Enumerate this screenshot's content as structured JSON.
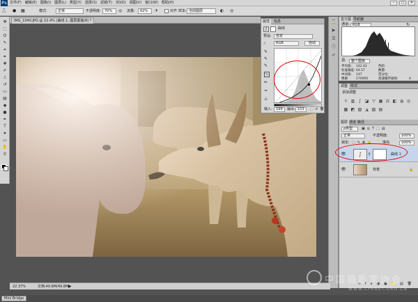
{
  "app": {
    "logo": "Ps"
  },
  "menubar": {
    "items": [
      "文件(F)",
      "编辑(E)",
      "图像(I)",
      "图层(L)",
      "类型(Y)",
      "选择(S)",
      "滤镜(T)",
      "3D(D)",
      "视图(V)",
      "窗口(W)",
      "帮助(H)"
    ],
    "window_controls": [
      "–",
      "□",
      "✕"
    ]
  },
  "options": {
    "mode_label": "模式:",
    "mode_value": "正常",
    "opacity_label": "不透明度:",
    "opacity_value": "70%",
    "flow_label": "流量:",
    "flow_value": "62%",
    "align_label": "对齐",
    "sample_label": "样本:",
    "sample_value": "当前图层"
  },
  "document": {
    "tab_title": "IMG_1040.JPG @ 22.4% (曲线 1, 图层蒙版/8) *"
  },
  "properties": {
    "tabs": [
      "属性",
      "信息"
    ],
    "header": "曲线",
    "preset_label": "预设:",
    "preset_value": "自定",
    "channel_value": "RGB",
    "auto_label": "自动",
    "input_label": "输入:",
    "input_value": "199",
    "output_label": "输出:",
    "output_value": "153"
  },
  "histogram": {
    "tabs": [
      "直方图",
      "导航器"
    ],
    "channel_label": "通道:",
    "channel_value": "RGB",
    "source_label": "源:",
    "source_value": "整个图像",
    "stats_left": [
      [
        "平均值:",
        "142.42"
      ],
      [
        "标准偏差:",
        "64.57"
      ],
      [
        "中间值:",
        "147"
      ],
      [
        "像素:",
        "270000"
      ]
    ],
    "stats_right": [
      [
        "色阶:",
        ""
      ],
      [
        "数量:",
        ""
      ],
      [
        "百分位:",
        ""
      ],
      [
        "高速缓存级别:",
        "4"
      ]
    ]
  },
  "adjustments": {
    "tabs": [
      "调整",
      "样式"
    ],
    "title": "添加调整"
  },
  "layers": {
    "tabs": [
      "图层",
      "通道",
      "路径"
    ],
    "kind_label": "ρ类型",
    "blend_value": "正常",
    "opacity_label": "不透明度:",
    "opacity_value": "100%",
    "lock_label": "锁定:",
    "fill_label": "填充:",
    "fill_value": "100%",
    "rows": [
      {
        "name": "曲线 1"
      },
      {
        "name": "背景"
      }
    ]
  },
  "status": {
    "zoom": "22.37%",
    "doc_info": "文档:49.8M/49.8M"
  },
  "minibridge": {
    "label": "Mini Bridge"
  },
  "watermark": {
    "text": "中国摄影家协会",
    "url": "WWW.CPANET.ORG.CN"
  },
  "colors": {
    "ui_bg": "#535353",
    "panel": "#d6d6d6",
    "selected_layer": "#c6d5ec",
    "annotation": "#e00000"
  }
}
